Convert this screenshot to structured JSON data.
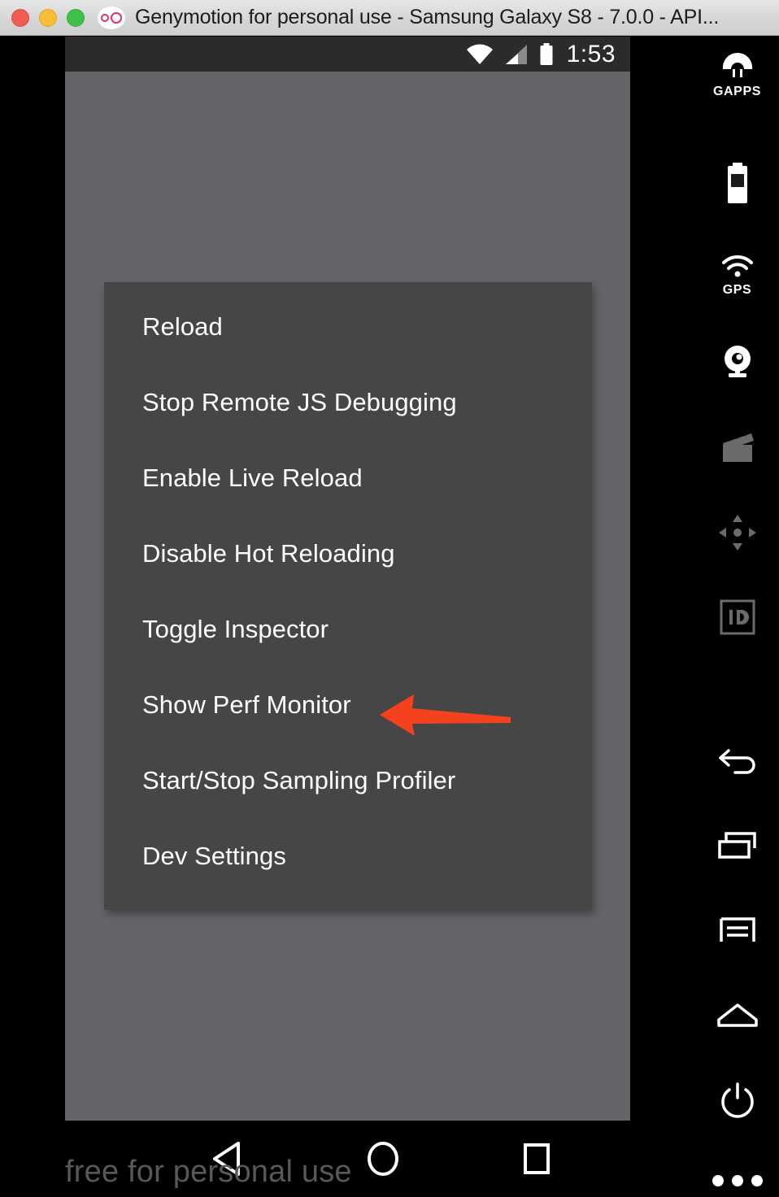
{
  "window": {
    "title": "Genymotion for personal use - Samsung Galaxy S8 - 7.0.0 - API...",
    "traffic_lights": [
      {
        "name": "close",
        "color": "#f05b52"
      },
      {
        "name": "minimize",
        "color": "#f7bd35"
      },
      {
        "name": "zoom",
        "color": "#3fc04a"
      }
    ],
    "logo_name": "genymotion-logo"
  },
  "status_bar": {
    "time": "1:53",
    "icons": [
      "wifi-icon",
      "cellular-signal-icon",
      "battery-icon"
    ],
    "background": "#2b2b2b"
  },
  "dev_menu": {
    "background": "#464646",
    "items": [
      {
        "label": "Reload",
        "name": "menu-item-reload"
      },
      {
        "label": "Stop Remote JS Debugging",
        "name": "menu-item-stop-remote-js-debugging"
      },
      {
        "label": "Enable Live Reload",
        "name": "menu-item-enable-live-reload"
      },
      {
        "label": "Disable Hot Reloading",
        "name": "menu-item-disable-hot-reloading"
      },
      {
        "label": "Toggle Inspector",
        "name": "menu-item-toggle-inspector"
      },
      {
        "label": "Show Perf Monitor",
        "name": "menu-item-show-perf-monitor"
      },
      {
        "label": "Start/Stop Sampling Profiler",
        "name": "menu-item-start-stop-sampling-profiler"
      },
      {
        "label": "Dev Settings",
        "name": "menu-item-dev-settings"
      }
    ]
  },
  "annotation": {
    "arrow_color": "#f4411e",
    "points_at": "Show Perf Monitor"
  },
  "navigation_bar": {
    "buttons": [
      {
        "name": "nav-back-button",
        "icon": "triangle-left-icon"
      },
      {
        "name": "nav-home-button",
        "icon": "circle-icon"
      },
      {
        "name": "nav-recents-button",
        "icon": "square-icon"
      }
    ]
  },
  "watermark": {
    "text": "free for personal use"
  },
  "toolbar": {
    "background": "#000000",
    "items": [
      {
        "name": "gapps-button",
        "icon": "android-head-icon",
        "label": "GAPPS",
        "enabled": true
      },
      {
        "name": "battery-button",
        "icon": "battery-icon",
        "label": "",
        "enabled": true
      },
      {
        "name": "gps-button",
        "icon": "gps-waves-icon",
        "label": "GPS",
        "enabled": true
      },
      {
        "name": "camera-button",
        "icon": "webcam-icon",
        "label": "",
        "enabled": true
      },
      {
        "name": "screencast-button",
        "icon": "clapperboard-icon",
        "label": "",
        "enabled": false
      },
      {
        "name": "dpad-button",
        "icon": "dpad-icon",
        "label": "",
        "enabled": false
      },
      {
        "name": "identifiers-button",
        "icon": "id-badge-icon",
        "label": "",
        "enabled": false
      },
      {
        "name": "back-button",
        "icon": "back-arrow-icon",
        "label": "",
        "enabled": true
      },
      {
        "name": "recent-apps-button",
        "icon": "recent-apps-icon",
        "label": "",
        "enabled": true
      },
      {
        "name": "menu-button",
        "icon": "menu-icon",
        "label": "",
        "enabled": true
      },
      {
        "name": "home-button",
        "icon": "home-icon",
        "label": "",
        "enabled": true
      },
      {
        "name": "power-button",
        "icon": "power-icon",
        "label": "",
        "enabled": true
      },
      {
        "name": "more-button",
        "icon": "ellipsis-icon",
        "label": "",
        "enabled": true
      }
    ]
  }
}
